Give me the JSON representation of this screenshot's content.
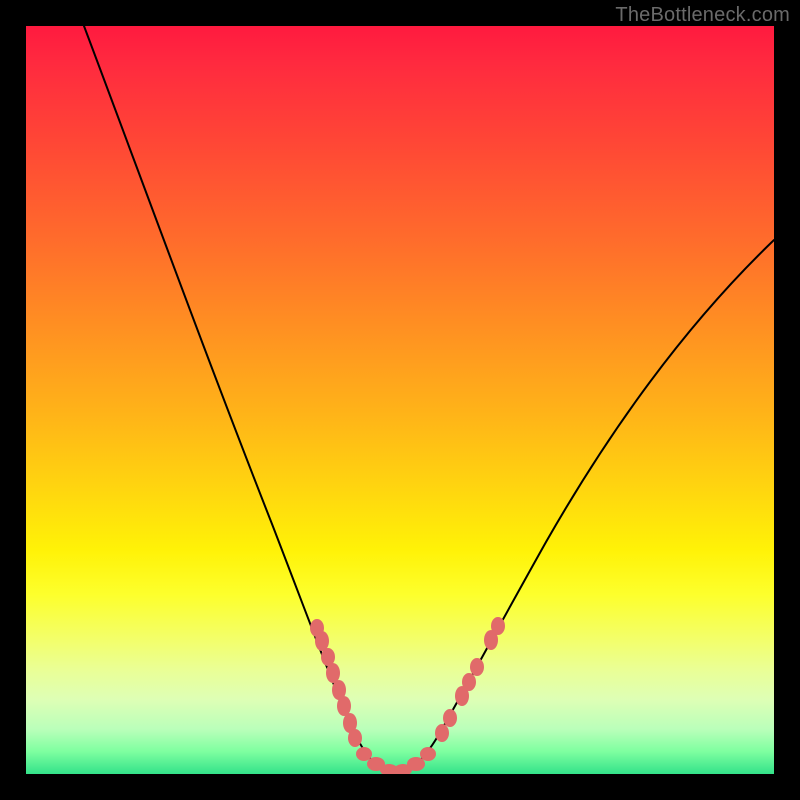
{
  "watermark": "TheBottleneck.com",
  "colors": {
    "frame": "#000000",
    "curve": "#000000",
    "dots": "#e16a6a",
    "gradient_top": "#ff1a3f",
    "gradient_bottom": "#33e28a"
  },
  "chart_data": {
    "type": "line",
    "title": "",
    "xlabel": "",
    "ylabel": "",
    "xlim": [
      0,
      100
    ],
    "ylim": [
      0,
      100
    ],
    "grid": false,
    "legend": false,
    "notes": "V-shaped bottleneck curve. No numeric axis ticks are rendered. x/y values below are estimated from pixel positions (0 = left/bottom, 100 = right/top). Color gradient encodes y: red=high, green=low.",
    "series": [
      {
        "name": "bottleneck-curve",
        "x": [
          0,
          5,
          10,
          15,
          20,
          25,
          30,
          35,
          38,
          40,
          42,
          44,
          46,
          48,
          50,
          52,
          55,
          60,
          65,
          70,
          75,
          80,
          85,
          90,
          95,
          100
        ],
        "y": [
          112,
          100,
          88,
          76,
          64,
          52,
          40,
          28,
          20,
          14,
          9,
          5,
          2,
          1,
          1,
          2,
          5,
          12,
          20,
          29,
          38,
          47,
          55,
          62,
          68,
          73
        ]
      }
    ],
    "annotations": {
      "dot_clusters": [
        {
          "name": "left-cluster",
          "approx_x_range": [
            37,
            45
          ],
          "approx_y_range": [
            3,
            20
          ]
        },
        {
          "name": "bottom-cluster",
          "approx_x_range": [
            44,
            53
          ],
          "approx_y_range": [
            1,
            3
          ]
        },
        {
          "name": "right-cluster",
          "approx_x_range": [
            54,
            61
          ],
          "approx_y_range": [
            6,
            16
          ]
        }
      ]
    }
  }
}
